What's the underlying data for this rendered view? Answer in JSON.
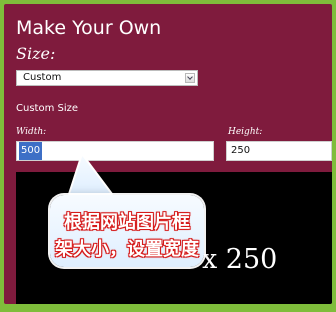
{
  "page": {
    "title": "Make Your Own",
    "size_label": "Size:",
    "size_value": "Custom",
    "custom_size_label": "Custom Size",
    "width_label": "Width:",
    "width_value": "500",
    "height_label": "Height:",
    "height_value": "250",
    "preview_dimensions": "x 250"
  },
  "tooltip": {
    "line_1": "根据网站图片框",
    "line_2": "架大小，设置宽度"
  },
  "colors": {
    "background": "#7fbd3b",
    "panel": "#7f1b3d",
    "selection": "#3d6fc6",
    "callout_text_outline": "#d51a1a"
  },
  "icons": {
    "dropdown": "chevron-down-icon",
    "callout": "callout-icon"
  }
}
